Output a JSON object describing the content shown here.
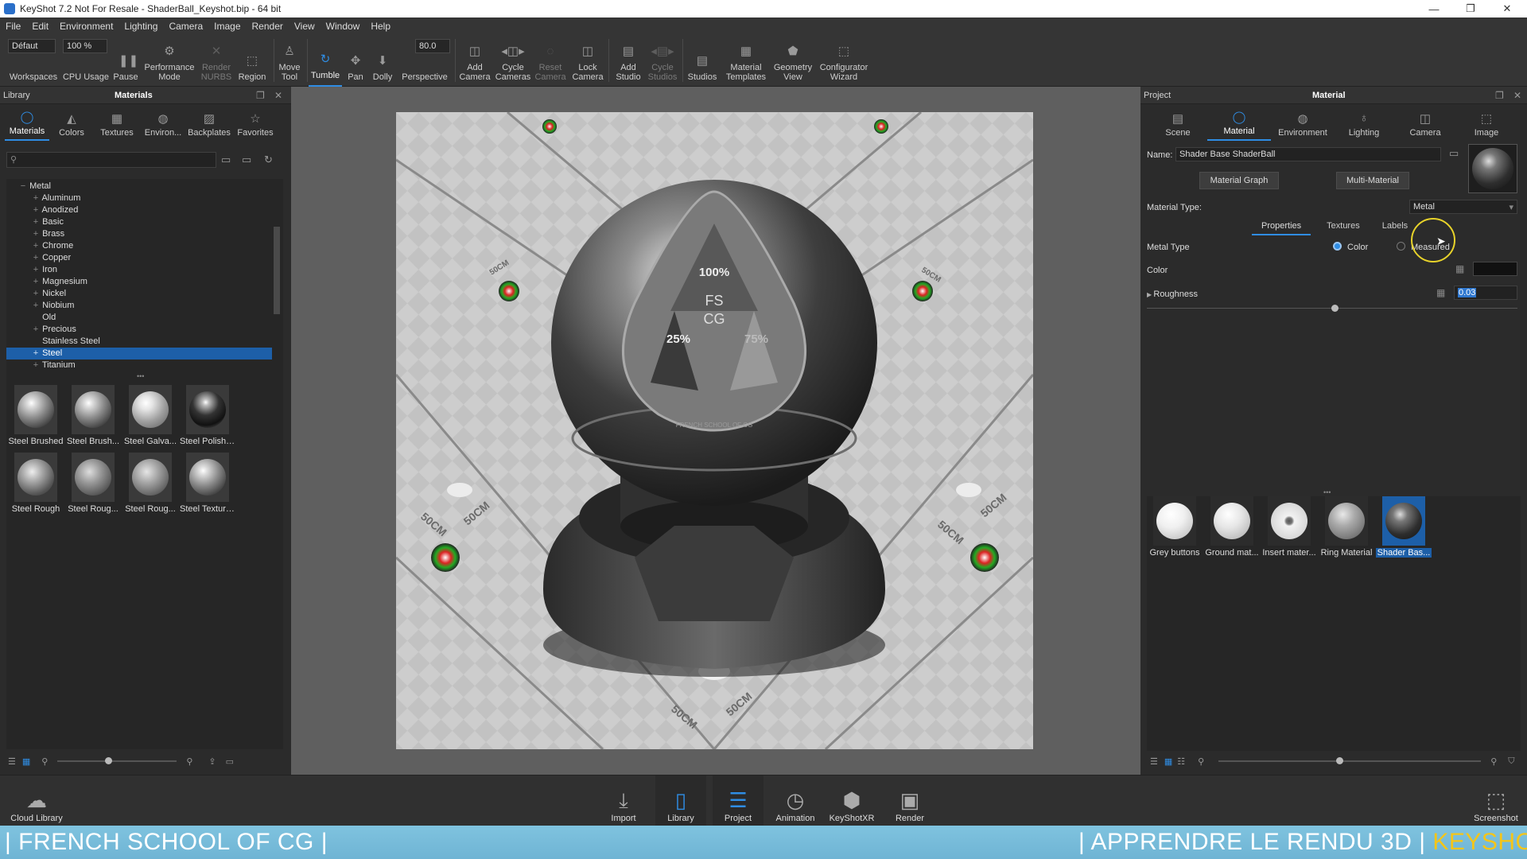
{
  "window": {
    "title": "KeyShot 7.2 Not For Resale - ShaderBall_Keyshot.bip - 64 bit",
    "minimize": "—",
    "maximize": "❐",
    "close": "✕"
  },
  "menu": [
    "File",
    "Edit",
    "Environment",
    "Lighting",
    "Camera",
    "Image",
    "Render",
    "View",
    "Window",
    "Help"
  ],
  "ribbon": {
    "workspace_value": "Défaut",
    "cpu_value": "100 %",
    "fov_value": "80.0",
    "items": [
      {
        "label": "Workspaces",
        "icon": "workspaces-icon",
        "glyph": ""
      },
      {
        "label": "CPU Usage",
        "icon": "cpu-icon",
        "glyph": ""
      },
      {
        "label": "Pause",
        "icon": "pause-icon",
        "glyph": "❚❚"
      },
      {
        "label": "Performance\nMode",
        "icon": "performance-icon",
        "glyph": "⚙"
      },
      {
        "label": "Render\nNURBS",
        "icon": "nurbs-icon",
        "glyph": "✕"
      },
      {
        "label": "Region",
        "icon": "region-icon",
        "glyph": "⬚"
      },
      {
        "label": "Move\nTool",
        "icon": "move-tool-icon",
        "glyph": "♙"
      },
      {
        "label": "Tumble",
        "icon": "tumble-icon",
        "glyph": "↻"
      },
      {
        "label": "Pan",
        "icon": "pan-icon",
        "glyph": "✥"
      },
      {
        "label": "Dolly",
        "icon": "dolly-icon",
        "glyph": "⬇"
      },
      {
        "label": "Perspective",
        "icon": "perspective-icon",
        "glyph": ""
      },
      {
        "label": "Add\nCamera",
        "icon": "add-camera-icon",
        "glyph": "◫"
      },
      {
        "label": "Cycle\nCameras",
        "icon": "cycle-cameras-icon",
        "glyph": "◂◫▸"
      },
      {
        "label": "Reset\nCamera",
        "icon": "reset-camera-icon",
        "glyph": "◌"
      },
      {
        "label": "Lock\nCamera",
        "icon": "lock-camera-icon",
        "glyph": "◫"
      },
      {
        "label": "Add\nStudio",
        "icon": "add-studio-icon",
        "glyph": "▤"
      },
      {
        "label": "Cycle\nStudios",
        "icon": "cycle-studios-icon",
        "glyph": "◂▤▸"
      },
      {
        "label": "Studios",
        "icon": "studios-icon",
        "glyph": "▤"
      },
      {
        "label": "Material\nTemplates",
        "icon": "material-templates-icon",
        "glyph": "▦"
      },
      {
        "label": "Geometry\nView",
        "icon": "geometry-view-icon",
        "glyph": "⬟"
      },
      {
        "label": "Configurator\nWizard",
        "icon": "configurator-icon",
        "glyph": "⬚"
      }
    ]
  },
  "library": {
    "header_left": "Library",
    "header_title": "Materials",
    "tabs": [
      {
        "label": "Materials",
        "glyph": "◯"
      },
      {
        "label": "Colors",
        "glyph": "◭"
      },
      {
        "label": "Textures",
        "glyph": "▦"
      },
      {
        "label": "Environ...",
        "glyph": "◍"
      },
      {
        "label": "Backplates",
        "glyph": "▨"
      },
      {
        "label": "Favorites",
        "glyph": "☆"
      }
    ],
    "search_placeholder": "",
    "tree_root": "Metal",
    "tree": [
      "Aluminum",
      "Anodized",
      "Basic",
      "Brass",
      "Chrome",
      "Copper",
      "Iron",
      "Magnesium",
      "Nickel",
      "Niobium",
      "Old",
      "Precious",
      "Stainless Steel",
      "Steel",
      "Titanium"
    ],
    "tree_expand": "+",
    "tree_collapse": "−",
    "divider": "•••",
    "thumbs": [
      "Steel Brushed",
      "Steel Brush...",
      "Steel Galva...",
      "Steel Polished",
      "Steel Rough",
      "Steel Roug...",
      "Steel Roug...",
      "Steel Textured"
    ]
  },
  "viewport": {
    "logo_top": "FS",
    "logo_bottom": "CG",
    "pct_100": "100%",
    "pct_25": "25%",
    "pct_75": "75%",
    "ring_text": "FRENCH SCHOOL OF CG",
    "dim_label": "50CM"
  },
  "project": {
    "header_left": "Project",
    "header_title": "Material",
    "tabs": [
      {
        "label": "Scene",
        "glyph": "▤"
      },
      {
        "label": "Material",
        "glyph": "◯"
      },
      {
        "label": "Environment",
        "glyph": "◍"
      },
      {
        "label": "Lighting",
        "glyph": "♁"
      },
      {
        "label": "Camera",
        "glyph": "◫"
      },
      {
        "label": "Image",
        "glyph": "⬚"
      }
    ],
    "name_label": "Name:",
    "name_value": "Shader Base ShaderBall",
    "material_graph": "Material Graph",
    "multi_material": "Multi-Material",
    "material_type_label": "Material Type:",
    "material_type_value": "Metal",
    "subtabs": [
      "Properties",
      "Textures",
      "Labels"
    ],
    "metal_type_label": "Metal Type",
    "opt_color": "Color",
    "opt_measured": "Measured",
    "color_label": "Color",
    "roughness_label": "Roughness",
    "roughness_value": "0.03",
    "divider": "•••",
    "materials": [
      "Grey buttons",
      "Ground mat...",
      "Insert mater...",
      "Ring Material",
      "Shader Bas..."
    ]
  },
  "bottom": {
    "cloud_library": "Cloud Library",
    "screenshot": "Screenshot",
    "buttons": [
      {
        "label": "Import",
        "glyph": "⤓"
      },
      {
        "label": "Library",
        "glyph": "▯"
      },
      {
        "label": "Project",
        "glyph": "☰"
      },
      {
        "label": "Animation",
        "glyph": "◷"
      },
      {
        "label": "KeyShotXR",
        "glyph": "⬢"
      },
      {
        "label": "Render",
        "glyph": "▣"
      }
    ]
  },
  "banner": {
    "left": "| FRENCH SCHOOL OF CG |",
    "right_a": "| APPRENDRE LE RENDU 3D |",
    "right_b": "KEYSHOT |"
  },
  "colors": {
    "accent": "#2f8de4",
    "selection": "#1d5fa8",
    "banner": "#7fc3df",
    "banner_highlight": "#f5c518"
  }
}
